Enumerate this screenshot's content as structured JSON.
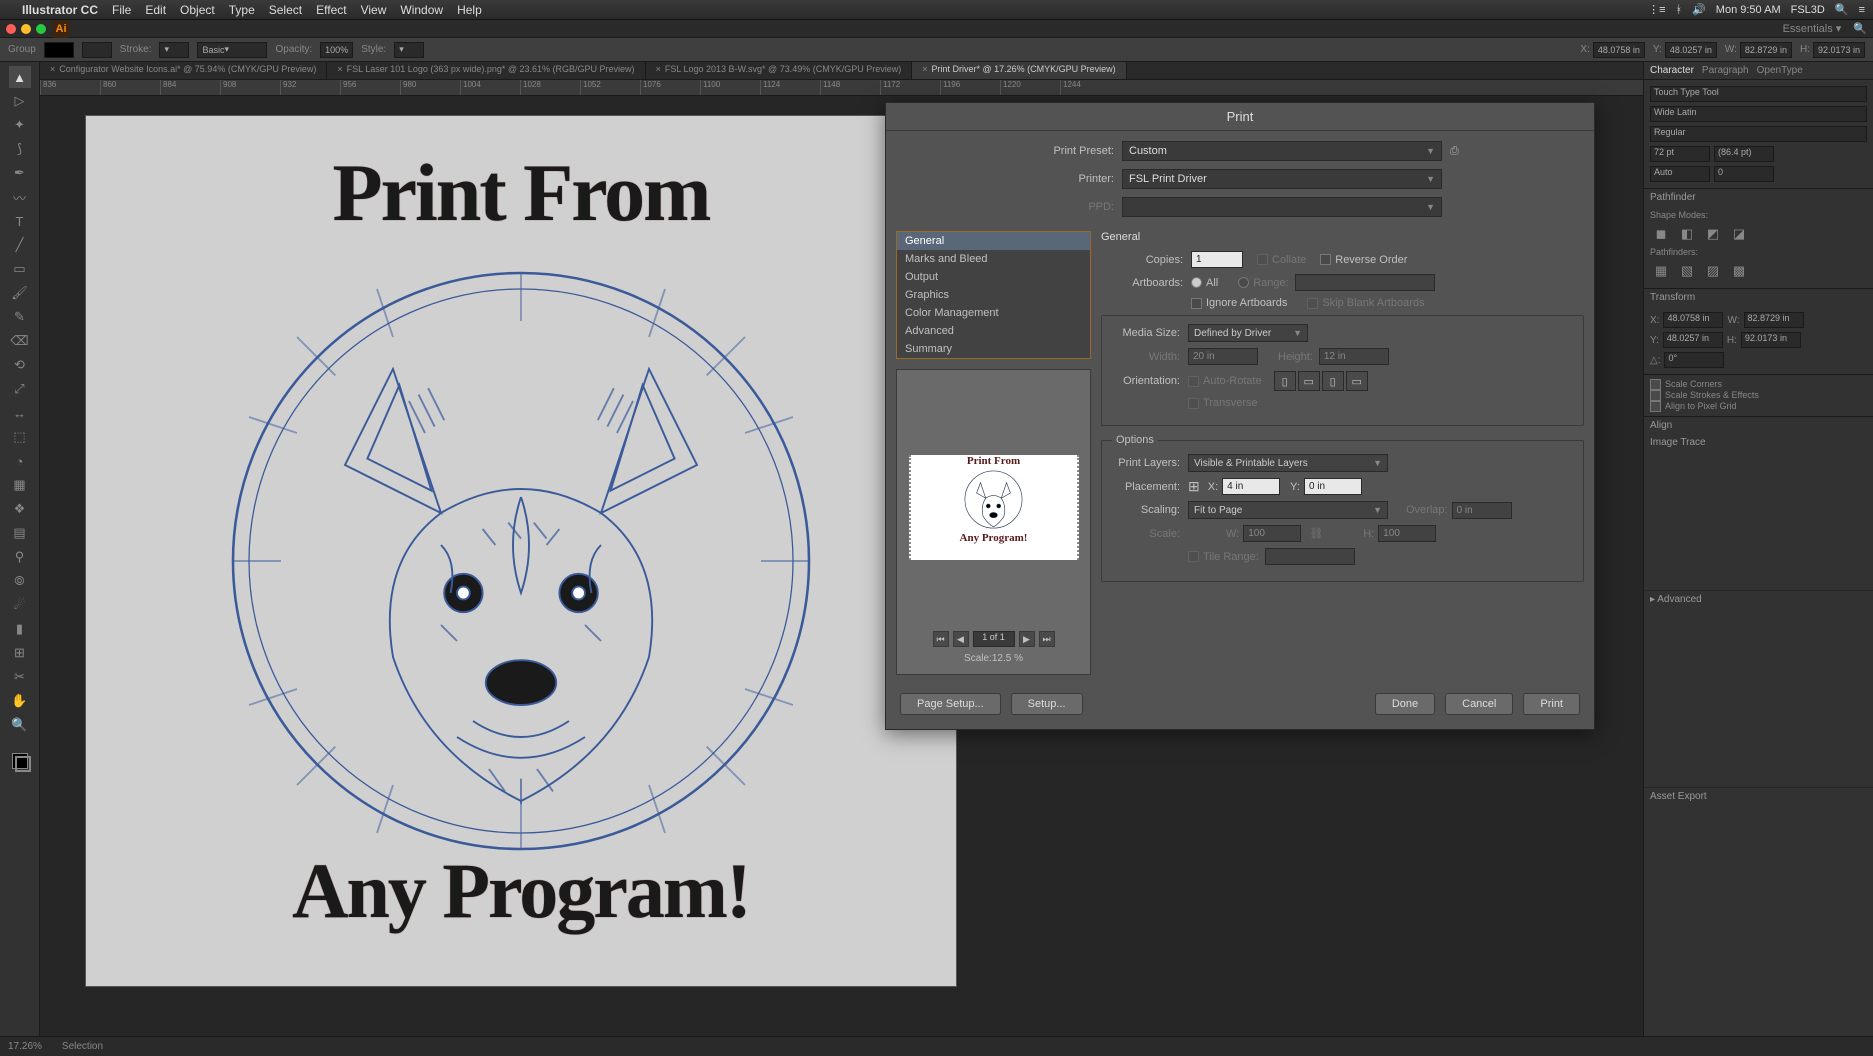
{
  "menubar": {
    "app": "Illustrator CC",
    "items": [
      "File",
      "Edit",
      "Object",
      "Type",
      "Select",
      "Effect",
      "View",
      "Window",
      "Help"
    ],
    "clock": "Mon 9:50 AM",
    "user": "FSL3D"
  },
  "workspace": "Essentials",
  "control": {
    "group": "Group",
    "stroke": "Stroke:",
    "basic": "Basic",
    "opacity_label": "Opacity:",
    "opacity": "100%",
    "style": "Style:",
    "x_label": "X:",
    "x": "48.0758 in",
    "y_label": "Y:",
    "y": "48.0257 in",
    "w_label": "W:",
    "w": "82.8729 in",
    "h_label": "H:",
    "h": "92.0173 in"
  },
  "tabs": [
    "Configurator Website Icons.ai* @ 75.94% (CMYK/GPU Preview)",
    "FSL Laser 101 Logo (363 px wide).png* @ 23.61% (RGB/GPU Preview)",
    "FSL Logo 2013 B-W.svg* @ 73.49% (CMYK/GPU Preview)",
    "Print Driver* @ 17.26% (CMYK/GPU Preview)"
  ],
  "active_tab": 3,
  "ruler_ticks": [
    "836",
    "860",
    "884",
    "908",
    "932",
    "956",
    "980",
    "1004",
    "1028",
    "1052",
    "1076",
    "1100",
    "1124",
    "1148",
    "1172",
    "1196",
    "1220",
    "1244"
  ],
  "artwork": {
    "title_top": "Print From",
    "title_bottom": "Any Program!"
  },
  "status": {
    "zoom": "17.26%",
    "mode": "Selection"
  },
  "panels": {
    "char_tabs": [
      "Character",
      "Paragraph",
      "OpenType"
    ],
    "touch_type": "Touch Type Tool",
    "font_fam": "Wide Latin",
    "font_style": "Regular",
    "size": "72 pt",
    "leading": "(86.4 pt)",
    "kerning": "Auto",
    "tracking": "0",
    "pathfinder": "Pathfinder",
    "shape_modes": "Shape Modes:",
    "pathfinders": "Pathfinders:",
    "transform": "Transform",
    "tx": "48.0758 in",
    "tw": "82.8729 in",
    "ty": "48.0257 in",
    "th": "92.0173 in",
    "angle": "0°",
    "scale_corners": "Scale Corners",
    "scale_strokes": "Scale Strokes & Effects",
    "align_grid": "Align to Pixel Grid",
    "align": "Align",
    "image_trace": "Image Trace",
    "advanced": "Advanced",
    "asset_export": "Asset Export"
  },
  "dialog": {
    "title": "Print",
    "preset_label": "Print Preset:",
    "preset_value": "Custom",
    "printer_label": "Printer:",
    "printer_value": "FSL Print Driver",
    "ppd_label": "PPD:",
    "categories": [
      "General",
      "Marks and Bleed",
      "Output",
      "Graphics",
      "Color Management",
      "Advanced",
      "Summary"
    ],
    "selected_category": 0,
    "general": {
      "title": "General",
      "copies_label": "Copies:",
      "copies": "1",
      "collate": "Collate",
      "reverse": "Reverse Order",
      "artboards_label": "Artboards:",
      "all": "All",
      "range_label": "Range:",
      "ignore": "Ignore Artboards",
      "skip": "Skip Blank Artboards"
    },
    "media": {
      "label": "Media Size:",
      "value": "Defined by Driver",
      "width_label": "Width:",
      "width": "20 in",
      "height_label": "Height:",
      "height": "12 in",
      "orient_label": "Orientation:",
      "auto_rotate": "Auto-Rotate",
      "transverse": "Transverse"
    },
    "options": {
      "title": "Options",
      "layers_label": "Print Layers:",
      "layers_value": "Visible & Printable Layers",
      "placement_label": "Placement:",
      "x_label": "X:",
      "x": "4 in",
      "y_label": "Y:",
      "y": "0 in",
      "scaling_label": "Scaling:",
      "scaling_value": "Fit to Page",
      "overlap_label": "Overlap:",
      "overlap": "0 in",
      "scale_label": "Scale:",
      "sw_label": "W:",
      "sw": "100",
      "sh_label": "H:",
      "sh": "100",
      "tile_label": "Tile Range:"
    },
    "preview": {
      "page": "1 of 1",
      "scale": "Scale:12.5 %",
      "top": "Print From",
      "bottom": "Any Program!"
    },
    "buttons": {
      "page_setup": "Page Setup...",
      "setup": "Setup...",
      "done": "Done",
      "cancel": "Cancel",
      "print": "Print"
    }
  }
}
